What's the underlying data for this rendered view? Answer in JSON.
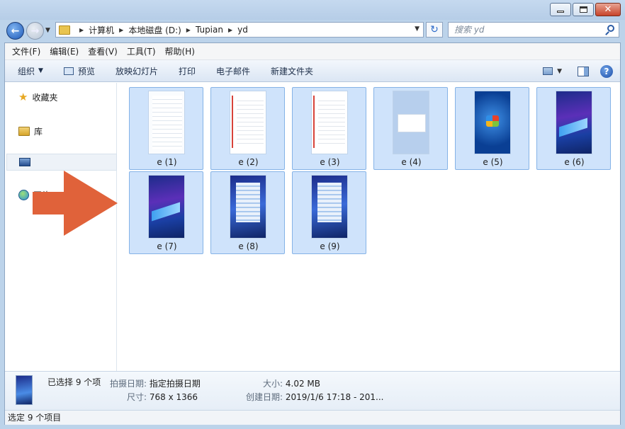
{
  "window": {
    "minimize_label": "",
    "maximize_label": "",
    "close_label": "✕"
  },
  "navigation": {
    "back_icon": "back-arrow-icon",
    "forward_icon": "forward-arrow-icon"
  },
  "address": {
    "crumbs": [
      "计算机",
      "本地磁盘 (D:)",
      "Tupian",
      "yd"
    ]
  },
  "search": {
    "placeholder": "搜索 yd"
  },
  "menu": {
    "items": [
      "文件(F)",
      "编辑(E)",
      "查看(V)",
      "工具(T)",
      "帮助(H)"
    ]
  },
  "toolbar": {
    "organize": "组织",
    "preview": "预览",
    "slideshow": "放映幻灯片",
    "print": "打印",
    "email": "电子邮件",
    "new_folder": "新建文件夹",
    "help": "?"
  },
  "sidebar": {
    "favorites": "收藏夹",
    "libraries": "库",
    "computer": "",
    "network": "网络"
  },
  "files": [
    {
      "name": "e (1)",
      "style": "doc-plain"
    },
    {
      "name": "e (2)",
      "style": "doc-red"
    },
    {
      "name": "e (3)",
      "style": "doc-red"
    },
    {
      "name": "e (4)",
      "style": "blue-box"
    },
    {
      "name": "e (5)",
      "style": "win7"
    },
    {
      "name": "e (6)",
      "style": "phone"
    },
    {
      "name": "e (7)",
      "style": "phone"
    },
    {
      "name": "e (8)",
      "style": "phone-overlay"
    },
    {
      "name": "e (9)",
      "style": "phone-overlay"
    }
  ],
  "details": {
    "selected": "已选择 9 个项",
    "date_taken_key": "拍摄日期:",
    "date_taken_val": "指定拍摄日期",
    "size_key": "大小:",
    "size_val": "4.02 MB",
    "dims_key": "尺寸:",
    "dims_val": "768 x 1366",
    "created_key": "创建日期:",
    "created_val": "2019/1/6 17:18 - 201..."
  },
  "status": {
    "text": "选定 9 个项目"
  },
  "colors": {
    "accent_arrow": "#e0623a",
    "selection": "#cfe3fb"
  }
}
